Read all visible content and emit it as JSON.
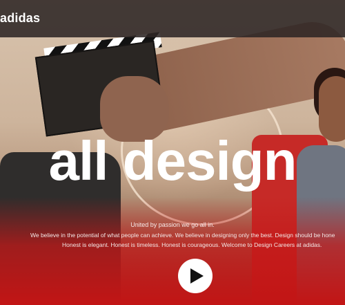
{
  "header": {
    "brand": "adidas"
  },
  "hero": {
    "headline": "all design",
    "tagline": "United by passion we go all in.",
    "body_line1": "We believe in the potential of what people can achieve. We believe in designing only the best. Design should be hone",
    "body_line2": "Honest is elegant. Honest is timeless. Honest is courageous. Welcome to Design Careers at adidas."
  },
  "icons": {
    "play": "play-icon"
  },
  "colors": {
    "accent_red": "#c21515",
    "header_bg": "#2d2624",
    "text": "#ffffff"
  }
}
